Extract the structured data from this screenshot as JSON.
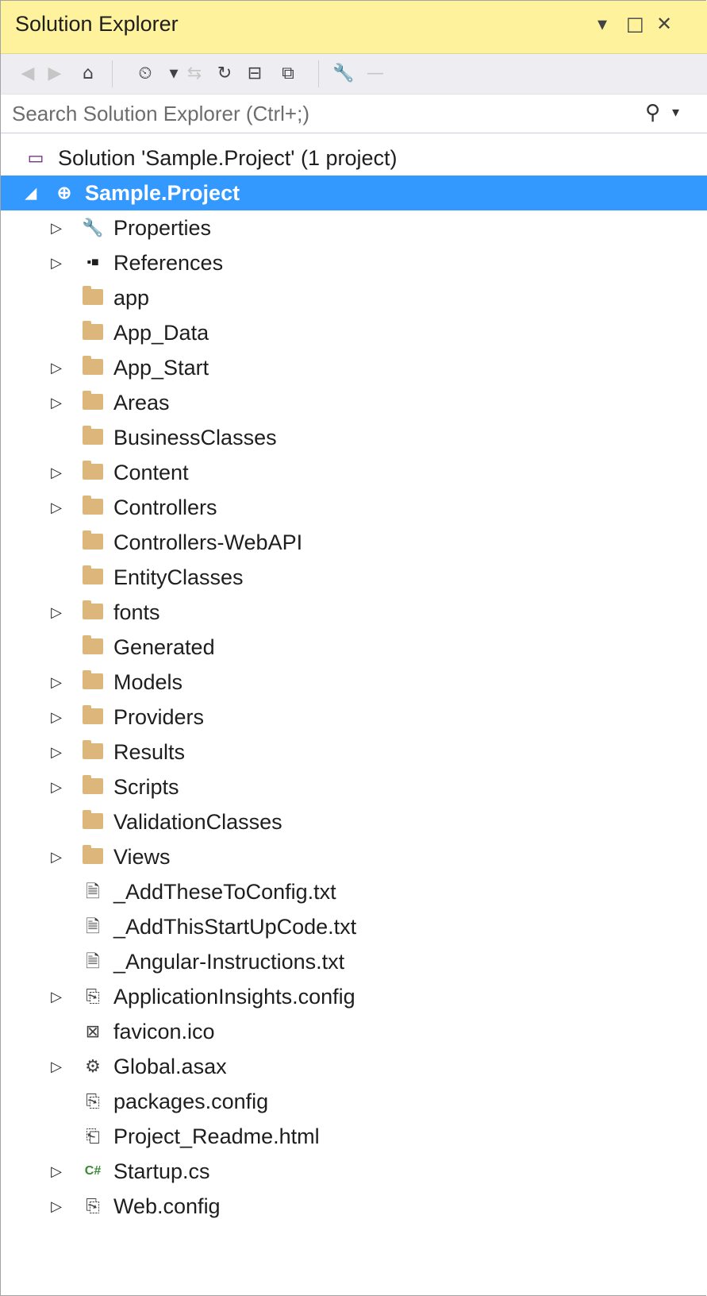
{
  "window": {
    "title": "Solution Explorer",
    "controls": {
      "dropdown": "▾",
      "maximize": "□",
      "close": "✕"
    }
  },
  "toolbar": {
    "items": [
      {
        "icon": "back-icon",
        "glyph": "◀",
        "enabled": false
      },
      {
        "icon": "forward-icon",
        "glyph": "▶",
        "enabled": false
      },
      {
        "icon": "home-icon",
        "glyph": "⌂",
        "enabled": true
      },
      {
        "icon": "pending-changes-filter-icon",
        "glyph": "⏲",
        "enabled": true
      },
      {
        "icon": "dropdown-icon",
        "glyph": "▾",
        "enabled": true
      },
      {
        "icon": "sync-icon",
        "glyph": "⇆",
        "enabled": false
      },
      {
        "icon": "refresh-icon",
        "glyph": "↻",
        "enabled": true
      },
      {
        "icon": "collapse-all-icon",
        "glyph": "⊟",
        "enabled": true
      },
      {
        "icon": "show-all-files-icon",
        "glyph": "⧉",
        "enabled": true
      },
      {
        "icon": "properties-wrench-icon",
        "glyph": "🔧",
        "enabled": true
      },
      {
        "icon": "preview-icon",
        "glyph": "—",
        "enabled": false
      }
    ]
  },
  "search": {
    "placeholder": "Search Solution Explorer (Ctrl+;)",
    "value": ""
  },
  "tree": [
    {
      "label": "Solution 'Sample.Project' (1 project)",
      "icon": "solution-icon",
      "glyph": "▭",
      "depth": 0,
      "arrow": ""
    },
    {
      "label": "Sample.Project",
      "icon": "web-project-icon",
      "glyph": "⊕",
      "depth": 1,
      "arrow": "◢",
      "selected": true
    },
    {
      "label": "Properties",
      "icon": "wrench-icon",
      "glyph": "🔧",
      "depth": 2,
      "arrow": "▷"
    },
    {
      "label": "References",
      "icon": "references-icon",
      "glyph": "▪■",
      "depth": 2,
      "arrow": "▷"
    },
    {
      "label": "app",
      "icon": "folder-icon",
      "depth": 2,
      "arrow": ""
    },
    {
      "label": "App_Data",
      "icon": "folder-icon",
      "depth": 2,
      "arrow": ""
    },
    {
      "label": "App_Start",
      "icon": "folder-icon",
      "depth": 2,
      "arrow": "▷"
    },
    {
      "label": "Areas",
      "icon": "folder-icon",
      "depth": 2,
      "arrow": "▷"
    },
    {
      "label": "BusinessClasses",
      "icon": "folder-icon",
      "depth": 2,
      "arrow": ""
    },
    {
      "label": "Content",
      "icon": "folder-icon",
      "depth": 2,
      "arrow": "▷"
    },
    {
      "label": "Controllers",
      "icon": "folder-icon",
      "depth": 2,
      "arrow": "▷"
    },
    {
      "label": "Controllers-WebAPI",
      "icon": "folder-icon",
      "depth": 2,
      "arrow": ""
    },
    {
      "label": "EntityClasses",
      "icon": "folder-icon",
      "depth": 2,
      "arrow": ""
    },
    {
      "label": "fonts",
      "icon": "folder-icon",
      "depth": 2,
      "arrow": "▷"
    },
    {
      "label": "Generated",
      "icon": "folder-icon",
      "depth": 2,
      "arrow": ""
    },
    {
      "label": "Models",
      "icon": "folder-icon",
      "depth": 2,
      "arrow": "▷"
    },
    {
      "label": "Providers",
      "icon": "folder-icon",
      "depth": 2,
      "arrow": "▷"
    },
    {
      "label": "Results",
      "icon": "folder-icon",
      "depth": 2,
      "arrow": "▷"
    },
    {
      "label": "Scripts",
      "icon": "folder-icon",
      "depth": 2,
      "arrow": "▷"
    },
    {
      "label": "ValidationClasses",
      "icon": "folder-icon",
      "depth": 2,
      "arrow": ""
    },
    {
      "label": "Views",
      "icon": "folder-icon",
      "depth": 2,
      "arrow": "▷"
    },
    {
      "label": "_AddTheseToConfig.txt",
      "icon": "text-file-icon",
      "glyph": "🗎",
      "depth": 2,
      "arrow": ""
    },
    {
      "label": "_AddThisStartUpCode.txt",
      "icon": "text-file-icon",
      "glyph": "🗎",
      "depth": 2,
      "arrow": ""
    },
    {
      "label": "_Angular-Instructions.txt",
      "icon": "text-file-icon",
      "glyph": "🗎",
      "depth": 2,
      "arrow": ""
    },
    {
      "label": "ApplicationInsights.config",
      "icon": "config-file-icon",
      "glyph": "⎘",
      "depth": 2,
      "arrow": "▷"
    },
    {
      "label": "favicon.ico",
      "icon": "image-file-icon",
      "glyph": "⊠",
      "depth": 2,
      "arrow": ""
    },
    {
      "label": "Global.asax",
      "icon": "asax-file-icon",
      "glyph": "⚙",
      "depth": 2,
      "arrow": "▷"
    },
    {
      "label": "packages.config",
      "icon": "config-file-icon",
      "glyph": "⎘",
      "depth": 2,
      "arrow": ""
    },
    {
      "label": "Project_Readme.html",
      "icon": "html-file-icon",
      "glyph": "⎗",
      "depth": 2,
      "arrow": ""
    },
    {
      "label": "Startup.cs",
      "icon": "csharp-file-icon",
      "glyph": "C#",
      "depth": 2,
      "arrow": "▷"
    },
    {
      "label": "Web.config",
      "icon": "config-file-icon",
      "glyph": "⎘",
      "depth": 2,
      "arrow": "▷"
    }
  ],
  "colors": {
    "titlebar": "#fff29d",
    "selection": "#3399ff",
    "folder": "#dcb67a",
    "toolbar": "#eeeef2",
    "csharp": "#388a34",
    "solution": "#68217a"
  }
}
